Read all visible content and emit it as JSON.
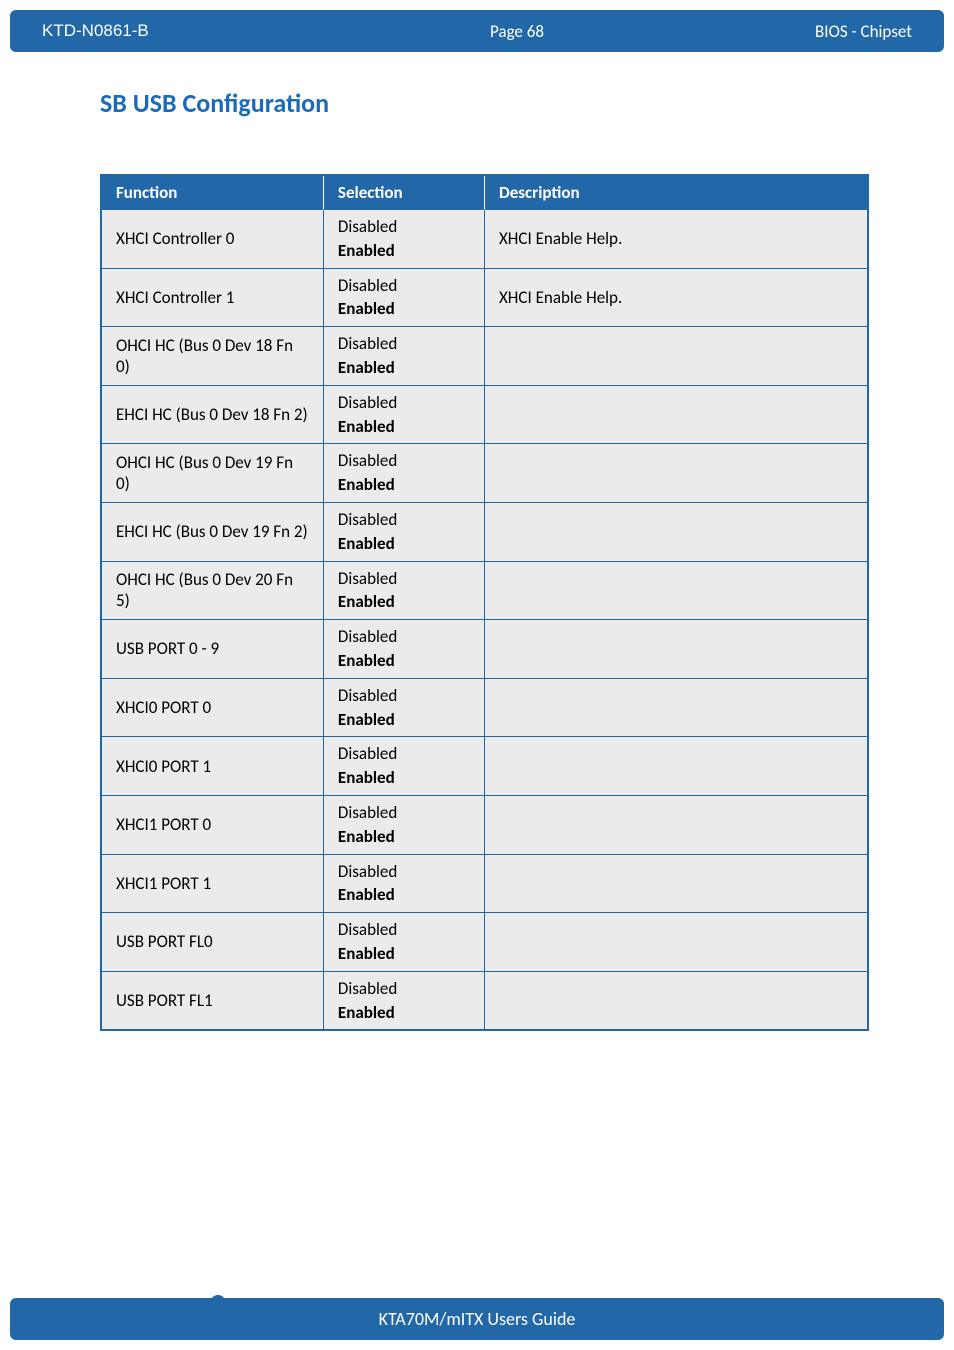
{
  "header": {
    "doc_id": "KTD-N0861-B",
    "page_label": "Page 68",
    "section": "BIOS  - Chipset"
  },
  "page": {
    "heading": "SB USB Configuration"
  },
  "table": {
    "columns": {
      "c0": "Function",
      "c1": "Selection",
      "c2": "Description"
    },
    "rows": [
      {
        "fn": "XHCI Controller 0",
        "sel_disabled": "Disabled",
        "sel_enabled": "Enabled",
        "desc": "XHCI Enable Help."
      },
      {
        "fn": "XHCI Controller 1",
        "sel_disabled": "Disabled",
        "sel_enabled": "Enabled",
        "desc": "XHCI Enable Help."
      },
      {
        "fn": "OHCI HC (Bus 0 Dev 18 Fn 0)",
        "sel_disabled": "Disabled",
        "sel_enabled": "Enabled",
        "desc": ""
      },
      {
        "fn": "EHCI HC (Bus 0 Dev 18 Fn 2)",
        "sel_disabled": "Disabled",
        "sel_enabled": "Enabled",
        "desc": ""
      },
      {
        "fn": "OHCI HC (Bus 0 Dev 19 Fn 0)",
        "sel_disabled": "Disabled",
        "sel_enabled": "Enabled",
        "desc": ""
      },
      {
        "fn": "EHCI HC (Bus 0 Dev 19 Fn 2)",
        "sel_disabled": "Disabled",
        "sel_enabled": "Enabled",
        "desc": ""
      },
      {
        "fn": "OHCI HC (Bus 0 Dev 20 Fn 5)",
        "sel_disabled": "Disabled",
        "sel_enabled": "Enabled",
        "desc": ""
      },
      {
        "fn": "USB PORT 0 - 9",
        "sel_disabled": "Disabled",
        "sel_enabled": "Enabled",
        "desc": ""
      },
      {
        "fn": "XHCI0 PORT 0",
        "sel_disabled": "Disabled",
        "sel_enabled": "Enabled",
        "desc": ""
      },
      {
        "fn": "XHCI0 PORT 1",
        "sel_disabled": "Disabled",
        "sel_enabled": "Enabled",
        "desc": ""
      },
      {
        "fn": "XHCI1 PORT 0",
        "sel_disabled": "Disabled",
        "sel_enabled": "Enabled",
        "desc": ""
      },
      {
        "fn": "XHCI1 PORT 1",
        "sel_disabled": "Disabled",
        "sel_enabled": "Enabled",
        "desc": ""
      },
      {
        "fn": "USB PORT FL0",
        "sel_disabled": "Disabled",
        "sel_enabled": "Enabled",
        "desc": ""
      },
      {
        "fn": "USB PORT FL1",
        "sel_disabled": "Disabled",
        "sel_enabled": "Enabled",
        "desc": ""
      }
    ]
  },
  "footer": {
    "text": "KTA70M/mITX Users Guide"
  }
}
